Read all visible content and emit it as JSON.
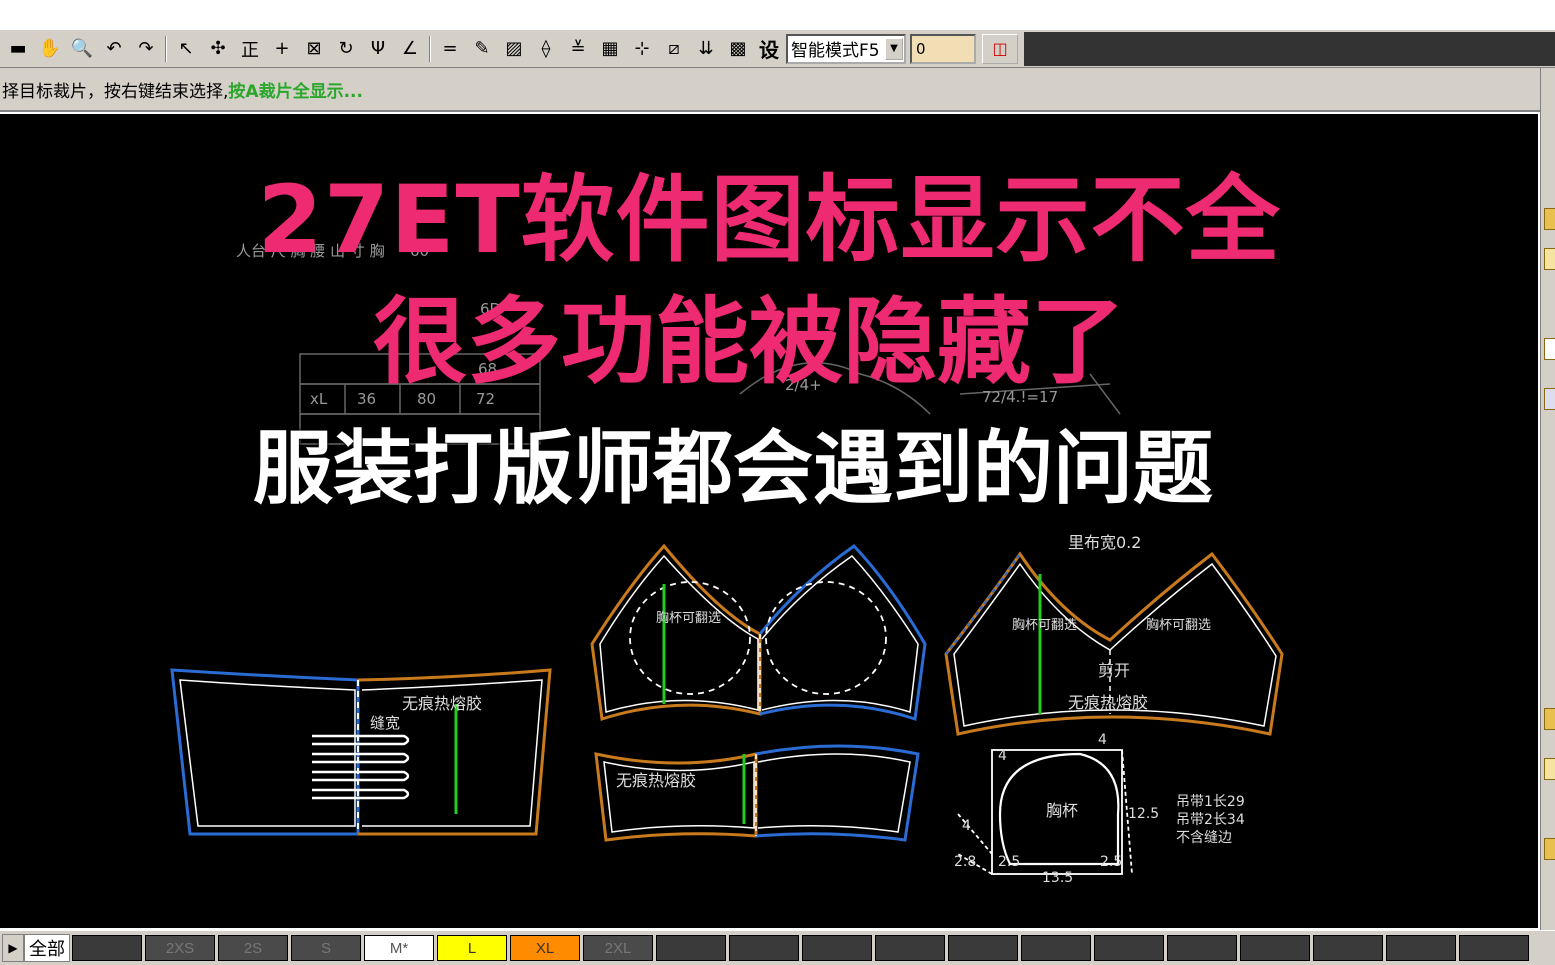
{
  "toolbar": {
    "tools": [
      {
        "name": "save-icon",
        "glyph": "▬"
      },
      {
        "name": "pan-hand-icon",
        "glyph": "✋"
      },
      {
        "name": "zoom-icon",
        "glyph": "🔍"
      },
      {
        "name": "undo-icon",
        "glyph": "↶"
      },
      {
        "name": "redo-icon",
        "glyph": "↷"
      },
      {
        "name": "select-pointer-icon",
        "glyph": "↖"
      },
      {
        "name": "move-icon",
        "glyph": "✣"
      },
      {
        "name": "align-icon",
        "glyph": "正"
      },
      {
        "name": "plus-icon",
        "glyph": "+"
      },
      {
        "name": "crop-icon",
        "glyph": "⊠"
      },
      {
        "name": "rotate-icon",
        "glyph": "↻"
      },
      {
        "name": "fork-icon",
        "glyph": "Ψ"
      },
      {
        "name": "angle-icon",
        "glyph": "∠"
      },
      {
        "name": "equal-icon",
        "glyph": "="
      },
      {
        "name": "pen-icon",
        "glyph": "✎"
      },
      {
        "name": "hatch-icon",
        "glyph": "▨"
      },
      {
        "name": "measure-icon",
        "glyph": "⟠"
      },
      {
        "name": "seam-icon",
        "glyph": "≚"
      },
      {
        "name": "color-grid-icon",
        "glyph": "▦"
      },
      {
        "name": "notch-icon",
        "glyph": "⊹"
      },
      {
        "name": "mirror-icon",
        "glyph": "⧄"
      },
      {
        "name": "pleat-icon",
        "glyph": "⇊"
      },
      {
        "name": "grade-icon",
        "glyph": "▩"
      }
    ],
    "settings_label": "设",
    "mode_value": "智能模式F5",
    "input_value": "0"
  },
  "statusbar": {
    "hint": "择目标裁片，按右键结束选择,",
    "hint_green": "按A裁片全显示..."
  },
  "overlay": {
    "line1": "27ET软件图标显示不全",
    "line2": "很多功能被隐藏了",
    "line3": "服装打版师都会遇到的问题"
  },
  "canvas_labels": {
    "bg_header": "人台 尺 胸 腰 山 寸 胸",
    "bg_size_xl": "xL",
    "bg_36": "36",
    "bg_80": "80",
    "bg_72": "72",
    "bg_60": "60",
    "bg_68": "68",
    "bg_6d": "6D",
    "bg_formula": "72/4.!=17",
    "bg_24": "2/4+",
    "piece1_label": "无痕热熔胶",
    "piece1_label2": "缝宽",
    "piece2_label": "胸杯可翻选",
    "piece3_label": "无痕热熔胶",
    "piece4_top": "里布宽0.2",
    "piece4_label_l": "胸杯可翻选",
    "piece4_label_r": "胸杯可翻选",
    "piece4_cut": "剪开",
    "piece4_bottom": "无痕热熔胶",
    "cup_label": "胸杯",
    "cup_dim_4a": "4",
    "cup_dim_4b": "4",
    "cup_dim_4c": "4",
    "cup_dim_125": "12.5",
    "cup_dim_28": "2.8",
    "cup_dim_25a": "2.5",
    "cup_dim_25b": "2.5",
    "cup_dim_135": "13.5",
    "strap1": "吊带1长29",
    "strap2": "吊带2长34",
    "strap3": "不含缝边"
  },
  "sizebar": {
    "all_label": "全部",
    "sizes": [
      {
        "label": "",
        "color": "#3a3a3a",
        "text_color": "#777777"
      },
      {
        "label": "2XS",
        "color": "#4a4a4a",
        "text_color": "#777777"
      },
      {
        "label": "2S",
        "color": "#4a4a4a",
        "text_color": "#777777"
      },
      {
        "label": "S",
        "color": "#4a4a4a",
        "text_color": "#777777"
      },
      {
        "label": "M*",
        "color": "#ffffff",
        "text_color": "#555555"
      },
      {
        "label": "L",
        "color": "#ffff00",
        "text_color": "#333333"
      },
      {
        "label": "XL",
        "color": "#ff8c00",
        "text_color": "#333333"
      },
      {
        "label": "2XL",
        "color": "#4a4a4a",
        "text_color": "#777777"
      },
      {
        "label": "",
        "color": "#3a3a3a",
        "text_color": "#777777"
      },
      {
        "label": "",
        "color": "#3a3a3a",
        "text_color": "#777777"
      },
      {
        "label": "",
        "color": "#3a3a3a",
        "text_color": "#777777"
      },
      {
        "label": "",
        "color": "#3a3a3a",
        "text_color": "#777777"
      },
      {
        "label": "",
        "color": "#3a3a3a",
        "text_color": "#777777"
      },
      {
        "label": "",
        "color": "#3a3a3a",
        "text_color": "#777777"
      },
      {
        "label": "",
        "color": "#3a3a3a",
        "text_color": "#777777"
      },
      {
        "label": "",
        "color": "#3a3a3a",
        "text_color": "#777777"
      },
      {
        "label": "",
        "color": "#3a3a3a",
        "text_color": "#777777"
      },
      {
        "label": "",
        "color": "#3a3a3a",
        "text_color": "#777777"
      },
      {
        "label": "",
        "color": "#3a3a3a",
        "text_color": "#777777"
      },
      {
        "label": "",
        "color": "#3a3a3a",
        "text_color": "#777777"
      }
    ]
  },
  "colors": {
    "title_pink": "#ee2a72",
    "outline_orange": "#c87a1c",
    "outline_blue": "#2a6bd4",
    "grain_green": "#22cc22"
  }
}
